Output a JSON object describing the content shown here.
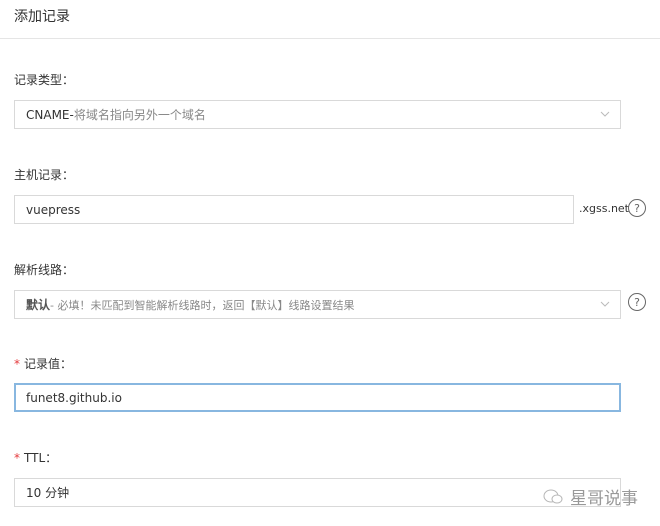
{
  "title": "添加记录",
  "record_type": {
    "label": "记录类型：",
    "value": "CNAME-",
    "hint": " 将域名指向另外一个域名"
  },
  "host": {
    "label": "主机记录：",
    "value": "vuepress",
    "suffix": ".xgss.net"
  },
  "line": {
    "label": "解析线路：",
    "value": "默认",
    "hint": " - 必填！未匹配到智能解析线路时，返回【默认】线路设置结果"
  },
  "value": {
    "required": "*",
    "label": "记录值：",
    "value": "funet8.github.io"
  },
  "ttl": {
    "required": "*",
    "label": "TTL：",
    "value": "10 分钟"
  },
  "help_glyph": "?",
  "watermark": "星哥说事"
}
